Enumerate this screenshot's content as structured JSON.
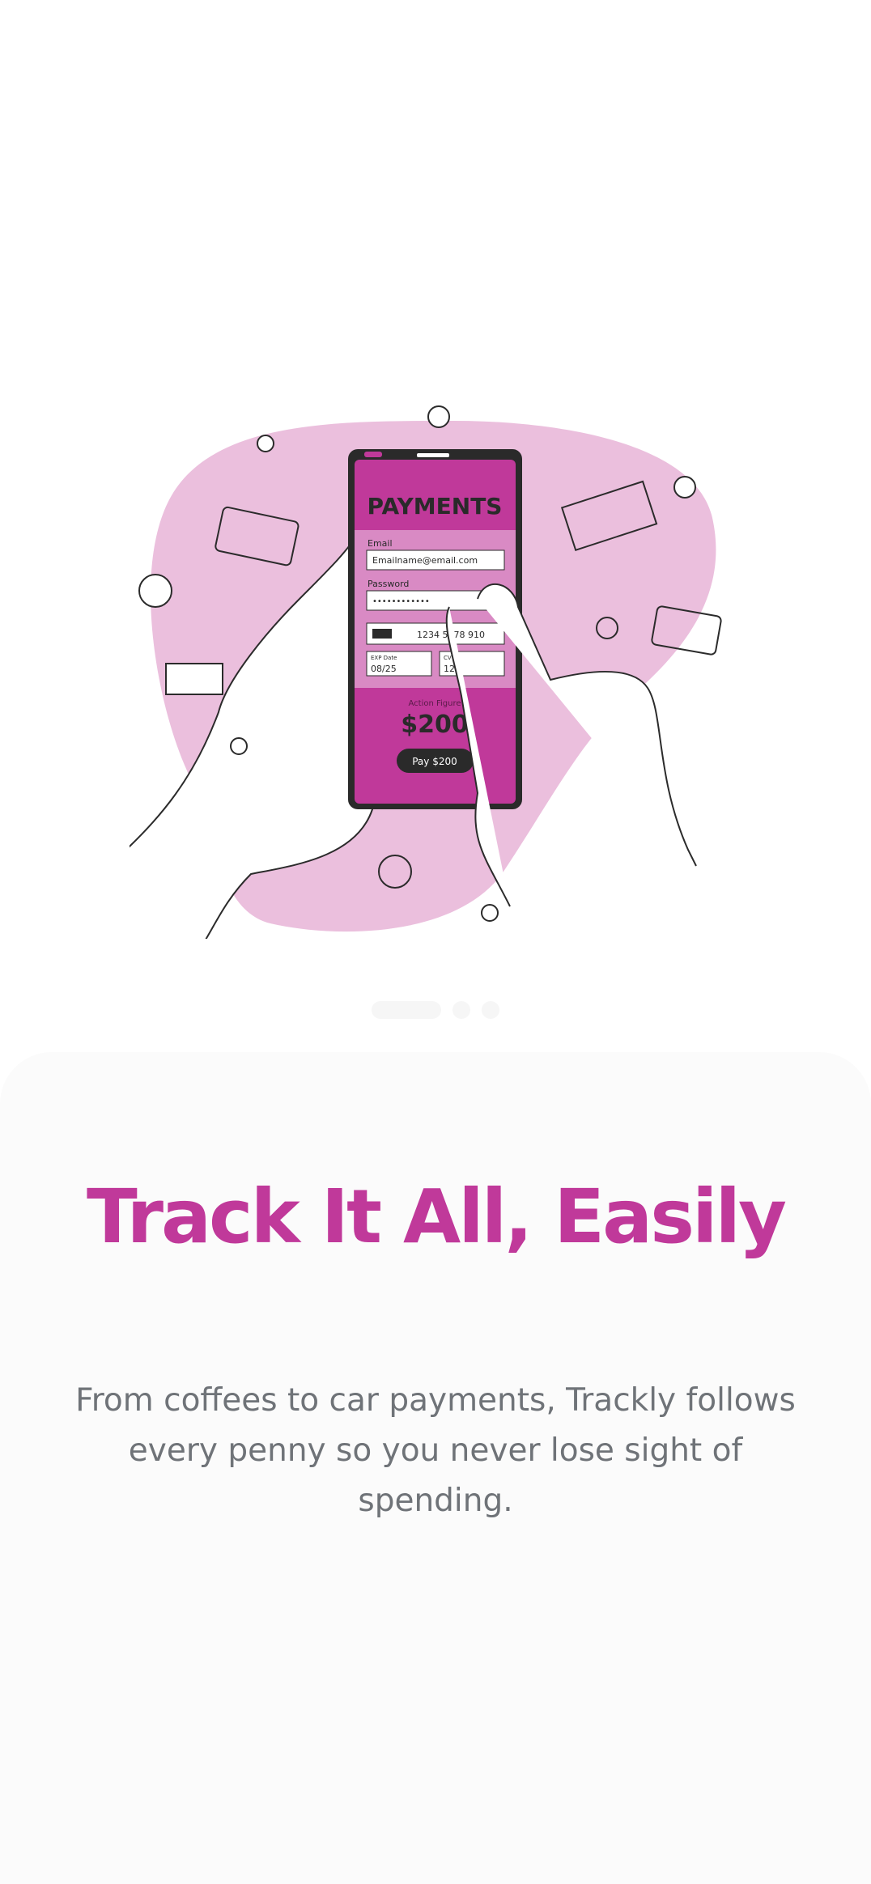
{
  "onboarding": {
    "illustration": {
      "phone_heading": "PAYMENTS",
      "email_label": "Email",
      "email_value": "Emailname@email.com",
      "password_label": "Password",
      "password_value": "••••••••••••",
      "card_number": "1234 5678 910",
      "exp_label": "EXP Date",
      "exp_value": "08/25",
      "cvv_label": "CVV",
      "cvv_value": "123",
      "amount_label": "Action Figure",
      "amount_value": "$200",
      "pay_button": "Pay $200",
      "blob_color": "#ebbfdd",
      "accent_color": "#c0399a"
    },
    "pager": {
      "total": 3,
      "active": 1
    },
    "title": "Track It All, Easily",
    "description": "From coffees to car payments, Trackly follows every penny so you never lose sight of spending."
  }
}
